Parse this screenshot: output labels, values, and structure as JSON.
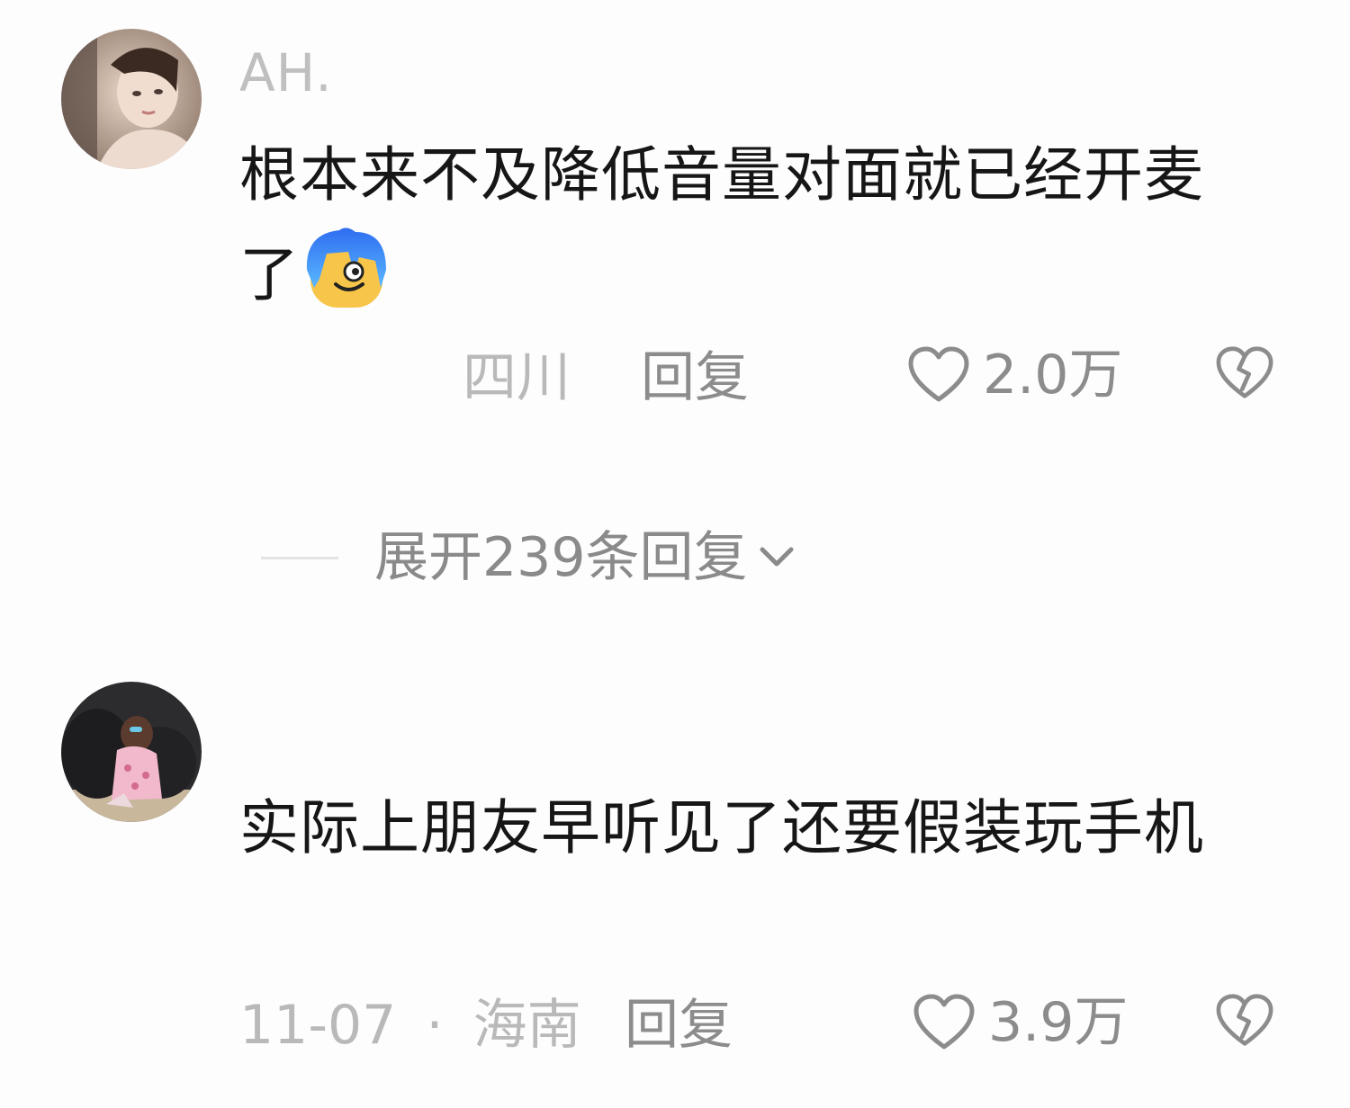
{
  "comments": [
    {
      "username": "AH.",
      "text": "根本来不及降低音量对面就已经开麦了",
      "emoji": "smirk-face-emoji",
      "date": "",
      "location": "四川",
      "reply_label": "回复",
      "likes": "2.0万"
    },
    {
      "username": "",
      "text": "实际上朋友早听见了还要假装玩手机",
      "date": "11-07",
      "separator": "·",
      "location": "海南",
      "reply_label": "回复",
      "likes": "3.9万"
    }
  ],
  "expand_replies": {
    "label": "展开239条回复"
  },
  "colors": {
    "background": "#fdfdfd",
    "text": "#161616",
    "muted": "#b9b9b9",
    "action": "#8c8c8c"
  },
  "icons": [
    "heart-outline-icon",
    "broken-heart-icon",
    "chevron-down-icon"
  ]
}
